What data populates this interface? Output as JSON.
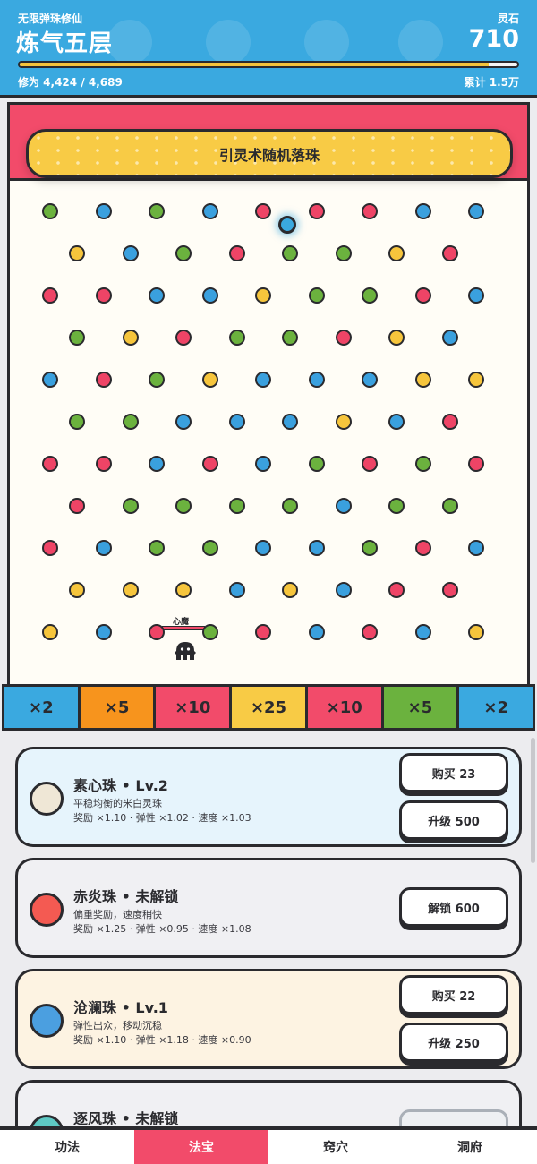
{
  "header": {
    "subtitle": "无限弹珠修仙",
    "realm": "炼气五层",
    "currency_label": "灵石",
    "currency_value": "710",
    "xp_text": "修为 4,424 / 4,689",
    "xp_fraction": 0.943,
    "total_text": "累计 1.5万"
  },
  "board": {
    "banner": "引灵术随机落珠",
    "hazard_label": "心魔",
    "colors": {
      "green": "#6bb23e",
      "blue": "#3aa0de",
      "red": "#ee4466",
      "yellow": "#f6c53c",
      "frame_red": "#f24b6a"
    },
    "peg_rows": [
      [
        "green",
        "blue",
        "green",
        "blue",
        "red",
        "red",
        "red",
        "blue",
        "blue"
      ],
      [
        "yellow",
        "blue",
        "green",
        "red",
        "green",
        "green",
        "yellow",
        "red"
      ],
      [
        "red",
        "red",
        "blue",
        "blue",
        "yellow",
        "green",
        "green",
        "red",
        "blue"
      ],
      [
        "green",
        "yellow",
        "red",
        "green",
        "green",
        "red",
        "yellow",
        "blue"
      ],
      [
        "blue",
        "red",
        "green",
        "yellow",
        "blue",
        "blue",
        "blue",
        "yellow",
        "yellow"
      ],
      [
        "green",
        "green",
        "blue",
        "blue",
        "blue",
        "yellow",
        "blue",
        "red"
      ],
      [
        "red",
        "red",
        "blue",
        "red",
        "blue",
        "green",
        "red",
        "green",
        "red"
      ],
      [
        "red",
        "green",
        "green",
        "green",
        "green",
        "blue",
        "green",
        "green"
      ],
      [
        "red",
        "blue",
        "green",
        "green",
        "blue",
        "blue",
        "green",
        "red",
        "blue"
      ],
      [
        "yellow",
        "yellow",
        "yellow",
        "blue",
        "yellow",
        "blue",
        "red",
        "red"
      ],
      [
        "yellow",
        "blue",
        "red",
        "green",
        "red",
        "blue",
        "red",
        "blue",
        "yellow"
      ]
    ]
  },
  "slots": [
    {
      "label": "×2",
      "color": "#3aa9e0"
    },
    {
      "label": "×5",
      "color": "#f7941d"
    },
    {
      "label": "×10",
      "color": "#f24b6a"
    },
    {
      "label": "×25",
      "color": "#f8cb45"
    },
    {
      "label": "×10",
      "color": "#f24b6a"
    },
    {
      "label": "×5",
      "color": "#6bb23e"
    },
    {
      "label": "×2",
      "color": "#3aa9e0"
    }
  ],
  "shop": [
    {
      "title": "素心珠 • Lv.2",
      "desc": "平稳均衡的米白灵珠",
      "stats": "奖励 ×1.10 · 弹性 ×1.02 · 速度 ×1.03",
      "orb_color": "#efe7d6",
      "bg": "#e6f4fc",
      "buttons": [
        "购买 23",
        "升级 500"
      ]
    },
    {
      "title": "赤炎珠 • 未解锁",
      "desc": "偏重奖励，速度稍快",
      "stats": "奖励 ×1.25 · 弹性 ×0.95 · 速度 ×1.08",
      "orb_color": "#f45a52",
      "bg": "#f0f0f3",
      "buttons": [
        "解锁 600"
      ]
    },
    {
      "title": "沧澜珠 • Lv.1",
      "desc": "弹性出众，移动沉稳",
      "stats": "奖励 ×1.10 · 弹性 ×1.18 · 速度 ×0.90",
      "orb_color": "#4b9fe0",
      "bg": "#fdf3e2",
      "buttons": [
        "购买 22",
        "升级 250"
      ]
    },
    {
      "title": "逐风珠 • 未解锁",
      "orb_color": "#5ec9c4",
      "bg": "#f0f0f3"
    }
  ],
  "nav": [
    {
      "label": "功法",
      "active": false
    },
    {
      "label": "法宝",
      "active": true
    },
    {
      "label": "窍穴",
      "active": false
    },
    {
      "label": "洞府",
      "active": false
    }
  ]
}
